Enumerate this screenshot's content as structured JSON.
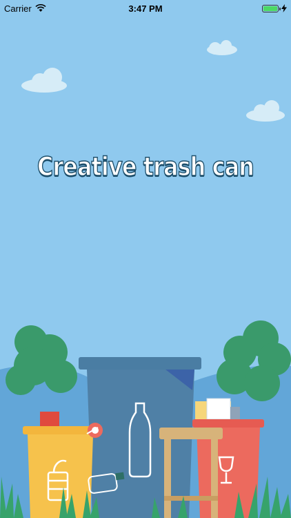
{
  "status_bar": {
    "carrier": "Carrier",
    "time": "3:47 PM",
    "battery_level": 1.0,
    "icons": [
      "wifi-icon",
      "battery-icon",
      "charging-icon"
    ]
  },
  "splash": {
    "title": "Creative trash can"
  },
  "colors": {
    "sky": "#8fc9ee",
    "hill": "#63a7d9",
    "tree": "#3a9a6b",
    "bin_blue": "#4f7fa4",
    "bin_yellow": "#f6c24c",
    "bin_red": "#ec6a5e",
    "stool": "#d7b37a"
  }
}
